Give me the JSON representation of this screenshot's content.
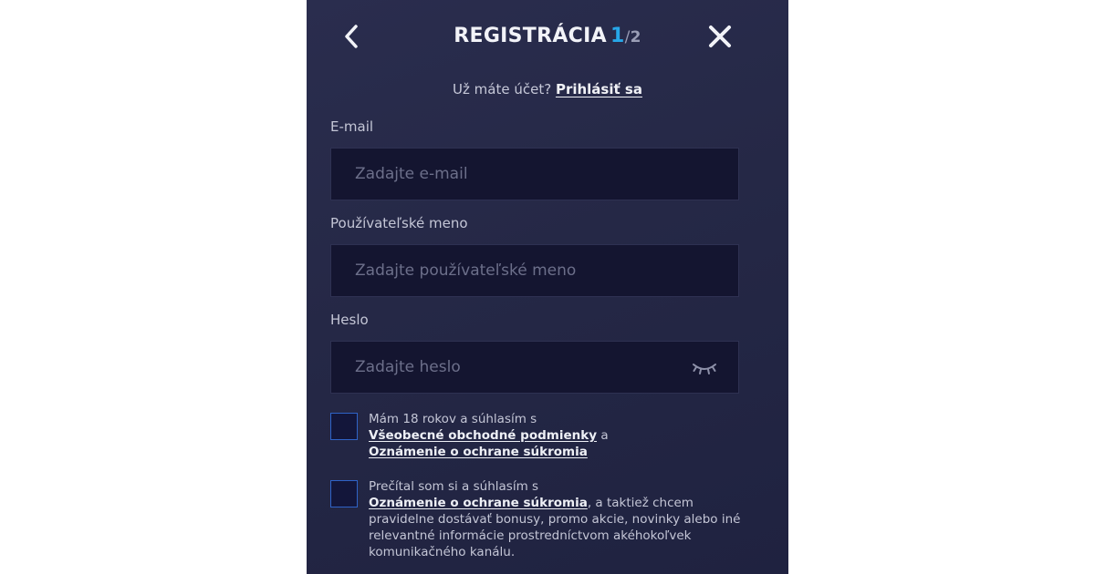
{
  "header": {
    "title": "REGISTRÁCIA",
    "step_current": "1",
    "step_separator": "/",
    "step_total": "2",
    "back_icon": "chevron-left-icon",
    "close_icon": "close-icon"
  },
  "login_prompt": {
    "text": "Už máte účet?",
    "link": "Prihlásiť sa"
  },
  "fields": {
    "email": {
      "label": "E-mail",
      "placeholder": "Zadajte e-mail",
      "value": ""
    },
    "username": {
      "label": "Používateľské meno",
      "placeholder": "Zadajte používateľské meno",
      "value": ""
    },
    "password": {
      "label": "Heslo",
      "placeholder": "Zadajte heslo",
      "value": "",
      "toggle_icon": "eye-closed-icon"
    }
  },
  "consents": {
    "age": {
      "prefix": "Mám 18 rokov a súhlasím s",
      "terms_link": "Všeobecné obchodné podmienky",
      "conjunction": "a",
      "privacy_link": "Oznámenie o ochrane súkromia",
      "checked": false
    },
    "marketing": {
      "prefix": "Prečítal som si a súhlasím s",
      "privacy_link": "Oznámenie o ochrane súkromia",
      "suffix": ", a taktiež chcem pravidelne dostávať bonusy, promo akcie, novinky alebo iné relevantné informácie prostredníctvom akéhokoľvek komunikačného kanálu.",
      "checked": false
    }
  },
  "colors": {
    "panel_bg": "#252846",
    "field_bg": "#141530",
    "accent": "#27a7e8",
    "checkbox_border": "#2f63c7"
  }
}
